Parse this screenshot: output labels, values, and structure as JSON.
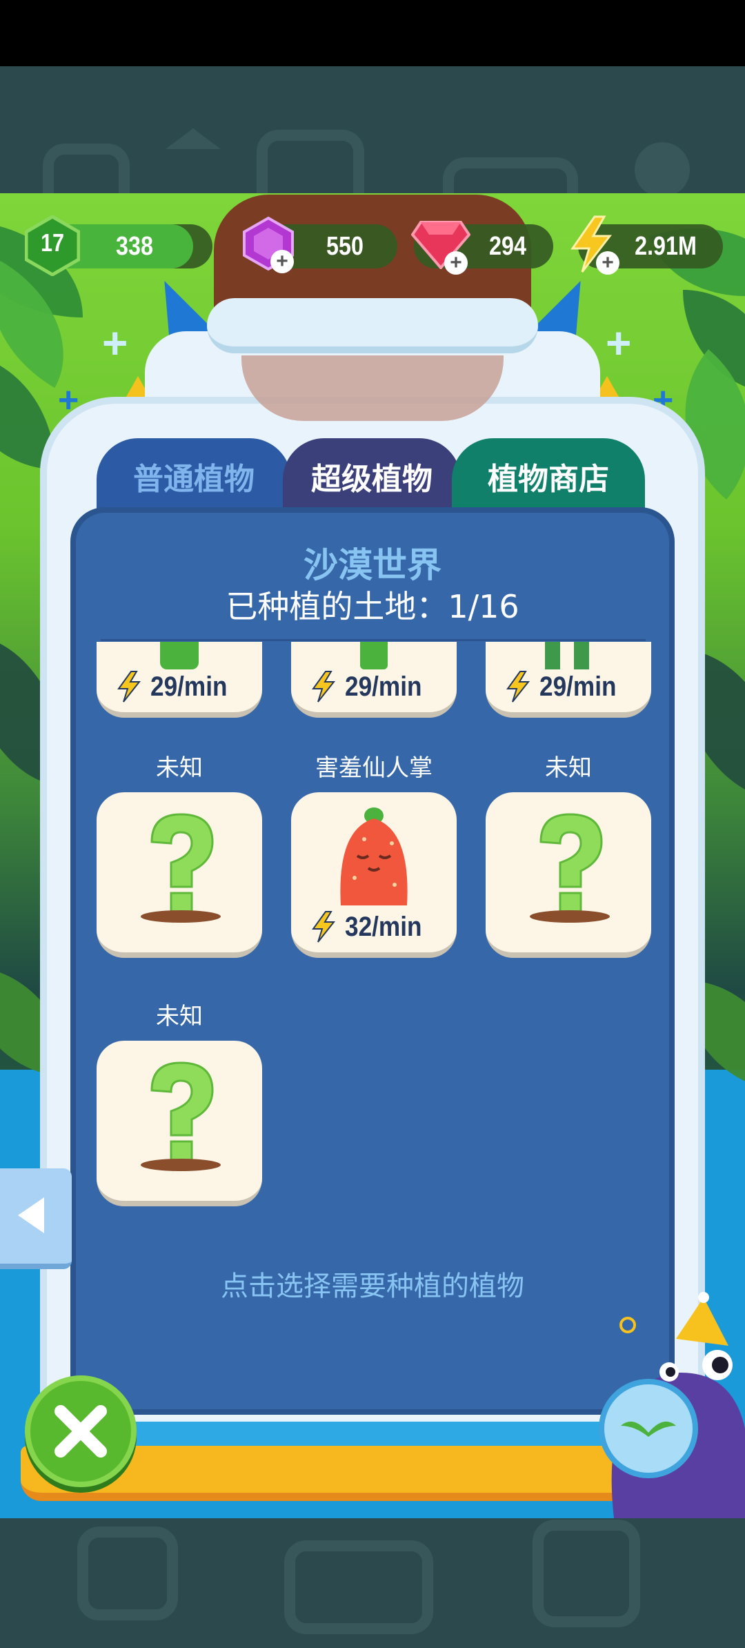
{
  "hud": {
    "level": "17",
    "xp": "338",
    "purple_gems": "550",
    "red_gems": "294",
    "energy": "2.91M"
  },
  "tabs": [
    {
      "label": "普通植物"
    },
    {
      "label": "超级植物"
    },
    {
      "label": "植物商店"
    }
  ],
  "panel": {
    "title": "沙漠世界",
    "subtitle": "已种植的土地：1/16",
    "hint": "点击选择需要种植的植物"
  },
  "top_row": [
    {
      "rate": "29/min"
    },
    {
      "rate": "29/min"
    },
    {
      "rate": "29/min"
    }
  ],
  "plants": [
    {
      "name": "未知",
      "rate": ""
    },
    {
      "name": "害羞仙人掌",
      "rate": "32/min"
    },
    {
      "name": "未知",
      "rate": ""
    },
    {
      "name": "未知",
      "rate": ""
    }
  ],
  "colors": {
    "panel": "#3667a8",
    "tab_normal": "#2d5aa4",
    "tab_super": "#3b3f7a",
    "tab_shop": "#11806a",
    "card": "#fdf6e6",
    "close_button": "#58b92f"
  },
  "icons": {
    "level": "level-hexagon-icon",
    "purple_gem": "purple-gem-icon",
    "red_gem": "red-gem-icon",
    "energy": "lightning-icon",
    "unknown_plant": "question-mark-icon",
    "back": "left-arrow-icon",
    "close": "close-icon"
  }
}
